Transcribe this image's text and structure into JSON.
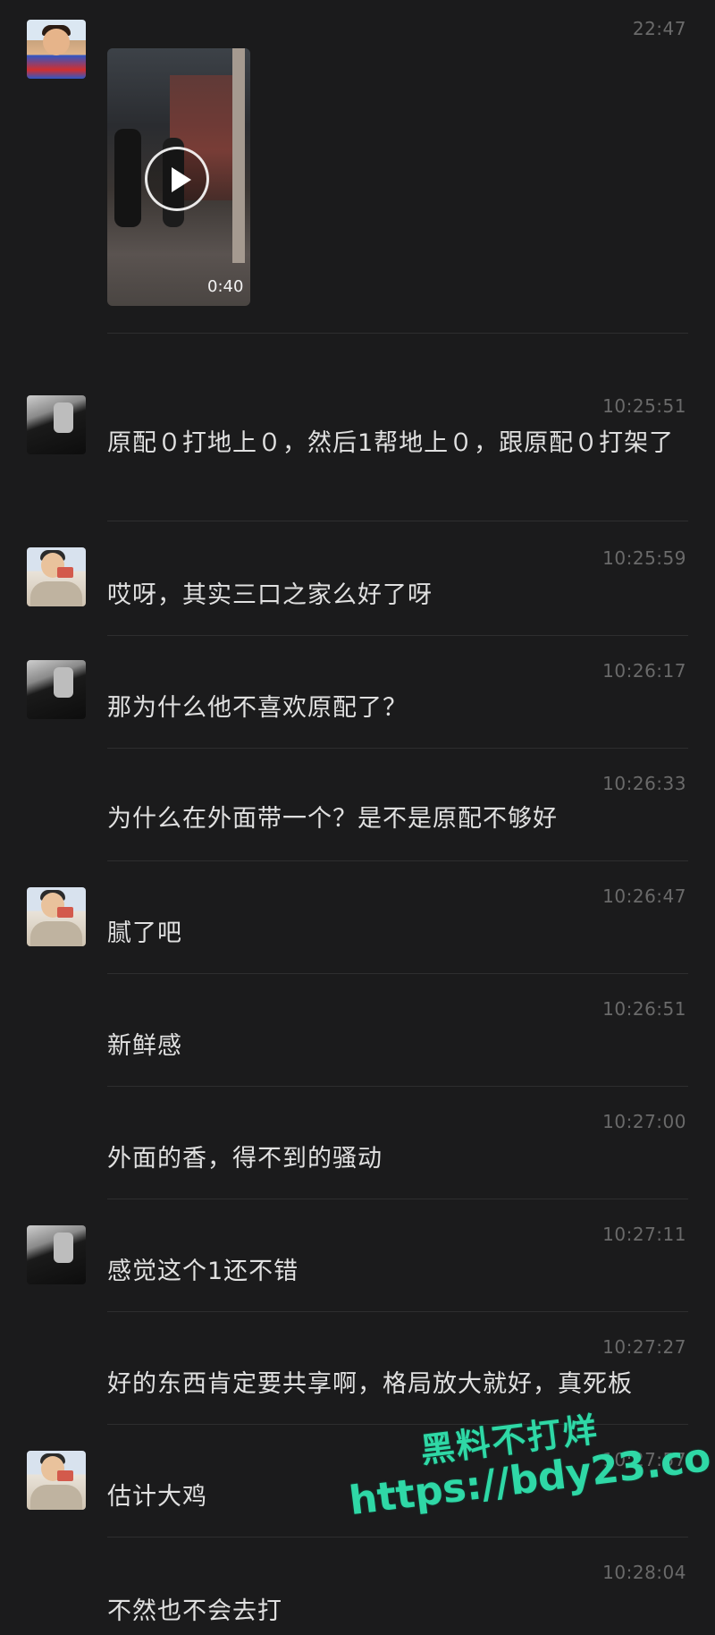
{
  "messages": [
    {
      "time": "22:47",
      "type": "video",
      "duration": "0:40",
      "avatar": "kid"
    },
    {
      "time": "10:25:51",
      "text": "原配０打地上０，然后1帮地上０，跟原配０打架了",
      "avatar": "dark"
    },
    {
      "time": "10:25:59",
      "text": "哎呀，其实三口之家么好了呀",
      "avatar": "light"
    },
    {
      "time": "10:26:17",
      "text": "那为什么他不喜欢原配了？",
      "avatar": "dark"
    },
    {
      "time": "10:26:33",
      "text": "为什么在外面带一个？是不是原配不够好",
      "avatar": ""
    },
    {
      "time": "10:26:47",
      "text": "腻了吧",
      "avatar": "light"
    },
    {
      "time": "10:26:51",
      "text": "新鲜感",
      "avatar": ""
    },
    {
      "time": "10:27:00",
      "text": "外面的香，得不到的骚动",
      "avatar": ""
    },
    {
      "time": "10:27:11",
      "text": "感觉这个1还不错",
      "avatar": "dark"
    },
    {
      "time": "10:27:27",
      "text": "好的东西肯定要共享啊，格局放大就好，真死板",
      "avatar": ""
    },
    {
      "time": "10:27:57",
      "text": "估计大鸡",
      "avatar": "light"
    },
    {
      "time": "10:28:04",
      "text": "不然也不会去打",
      "avatar": ""
    }
  ],
  "watermark": {
    "line1": "黑料不打烊",
    "line2": "https://bdy23.co"
  }
}
